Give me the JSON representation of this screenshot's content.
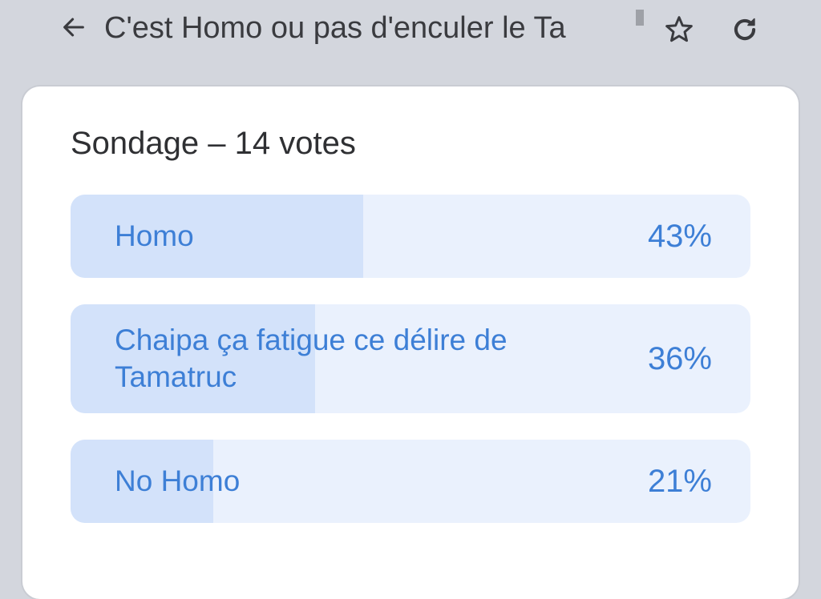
{
  "header": {
    "title": "C'est Homo ou pas d'enculer le Ta",
    "back_icon": "arrow-left-icon",
    "star_icon": "star-outline-icon",
    "refresh_icon": "refresh-icon"
  },
  "poll": {
    "title": "Sondage – 14 votes",
    "options": [
      {
        "label": "Homo",
        "percent_text": "43%",
        "fraction": 0.43
      },
      {
        "label": "Chaipa ça fatigue ce délire de Tamatruc",
        "percent_text": "36%",
        "fraction": 0.36
      },
      {
        "label": "No Homo",
        "percent_text": "21%",
        "fraction": 0.21
      }
    ]
  },
  "colors": {
    "accent": "#3d7fd6",
    "option_background": "#eaf1fd",
    "option_fill": "#d3e2fa",
    "page_background": "#d3d6dd"
  }
}
